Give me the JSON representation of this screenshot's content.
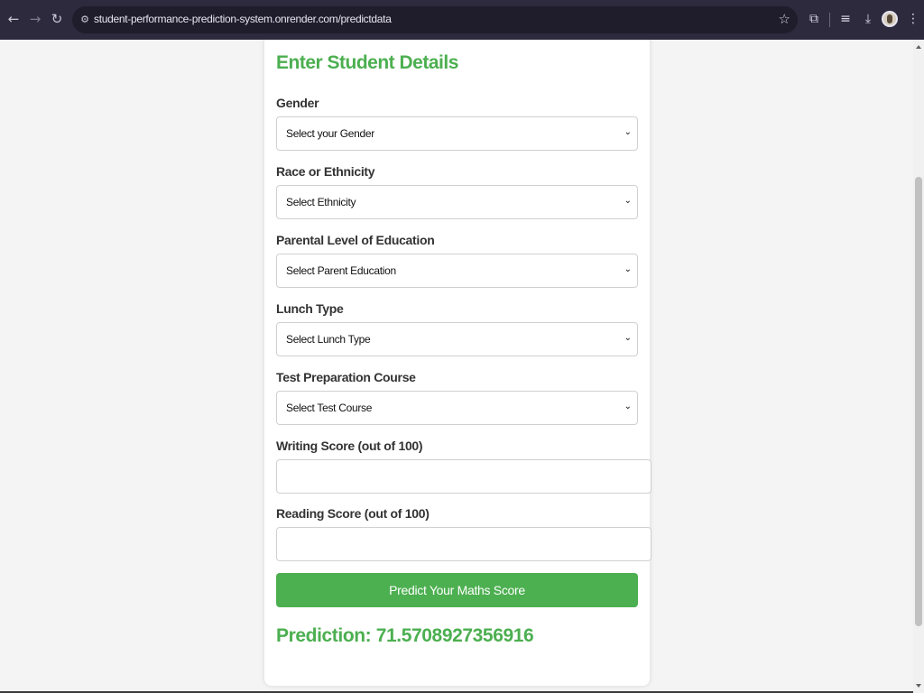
{
  "browser": {
    "url": "student-performance-prediction-system.onrender.com/predictdata",
    "back_icon": "arrow-left",
    "forward_icon": "arrow-right",
    "reload_icon": "reload",
    "site_info_icon": "tune",
    "bookmark_icon": "star",
    "extensions_icon": "puzzle",
    "reading_list_icon": "list",
    "download_icon": "download",
    "menu_icon": "more-vertical"
  },
  "form": {
    "heading": "Enter Student Details",
    "gender": {
      "label": "Gender",
      "value": "Select your Gender"
    },
    "ethnicity": {
      "label": "Race or Ethnicity",
      "value": "Select Ethnicity"
    },
    "parent_education": {
      "label": "Parental Level of Education",
      "value": "Select Parent Education"
    },
    "lunch": {
      "label": "Lunch Type",
      "value": "Select Lunch Type"
    },
    "test_prep": {
      "label": "Test Preparation Course",
      "value": "Select Test Course"
    },
    "writing_score": {
      "label": "Writing Score (out of 100)",
      "value": ""
    },
    "reading_score": {
      "label": "Reading Score (out of 100)",
      "value": ""
    },
    "submit_label": "Predict Your Maths Score"
  },
  "result": {
    "prediction_text": "Prediction: 71.5708927356916"
  },
  "colors": {
    "accent": "#4caf50",
    "chrome_bg": "#2d2a3e",
    "page_bg": "#f4f4f4"
  }
}
